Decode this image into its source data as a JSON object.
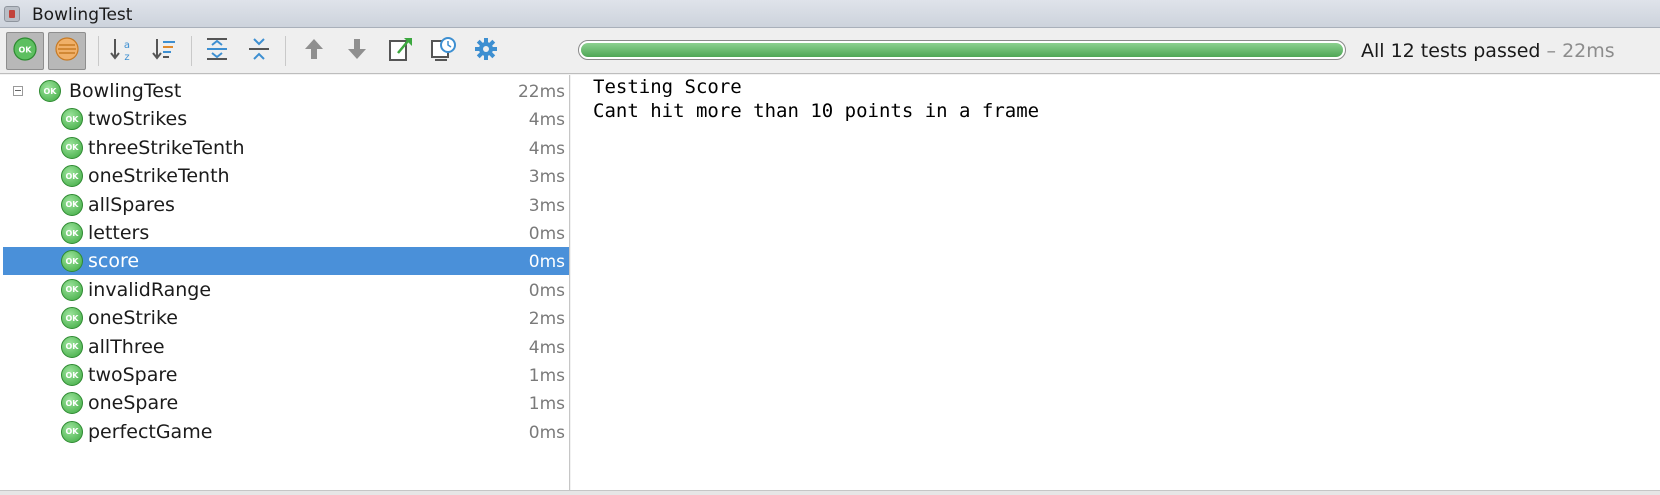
{
  "window": {
    "title": "BowlingTest"
  },
  "toolbar": {
    "buttons": [
      {
        "name": "show-passed-button",
        "icon": "ok-circle-icon"
      },
      {
        "name": "show-ignored-button",
        "icon": "ignored-icon"
      },
      {
        "name": "sort-alphabetically-button",
        "icon": "sort-az-icon"
      },
      {
        "name": "sort-by-duration-button",
        "icon": "sort-duration-icon"
      },
      {
        "name": "expand-all-button",
        "icon": "expand-all-icon"
      },
      {
        "name": "collapse-all-button",
        "icon": "collapse-all-icon"
      },
      {
        "name": "previous-test-button",
        "icon": "arrow-up-icon"
      },
      {
        "name": "next-test-button",
        "icon": "arrow-down-icon"
      },
      {
        "name": "export-results-button",
        "icon": "export-icon"
      },
      {
        "name": "test-history-button",
        "icon": "history-clock-icon"
      },
      {
        "name": "settings-button",
        "icon": "gear-icon"
      }
    ],
    "progress_fraction": 1.0,
    "summary_text": "All 12 tests passed",
    "summary_duration": " – 22ms"
  },
  "tree": {
    "root": {
      "name": "BowlingTest",
      "time": "22ms",
      "status": "OK"
    },
    "tests": [
      {
        "name": "twoStrikes",
        "time": "4ms",
        "status": "OK"
      },
      {
        "name": "threeStrikeTenth",
        "time": "4ms",
        "status": "OK"
      },
      {
        "name": "oneStrikeTenth",
        "time": "3ms",
        "status": "OK"
      },
      {
        "name": "allSpares",
        "time": "3ms",
        "status": "OK"
      },
      {
        "name": "letters",
        "time": "0ms",
        "status": "OK"
      },
      {
        "name": "score",
        "time": "0ms",
        "status": "OK",
        "selected": true
      },
      {
        "name": "invalidRange",
        "time": "0ms",
        "status": "OK"
      },
      {
        "name": "oneStrike",
        "time": "2ms",
        "status": "OK"
      },
      {
        "name": "allThree",
        "time": "4ms",
        "status": "OK"
      },
      {
        "name": "twoSpare",
        "time": "1ms",
        "status": "OK"
      },
      {
        "name": "oneSpare",
        "time": "1ms",
        "status": "OK"
      },
      {
        "name": "perfectGame",
        "time": "0ms",
        "status": "OK"
      }
    ]
  },
  "console": {
    "lines": [
      "Testing Score",
      "Cant hit more than 10 points in a frame"
    ]
  },
  "colors": {
    "selection": "#4a90d9",
    "pass_green": "#3ca83f",
    "progress_green": "#5fb264",
    "accent_blue": "#3d8fd1"
  }
}
